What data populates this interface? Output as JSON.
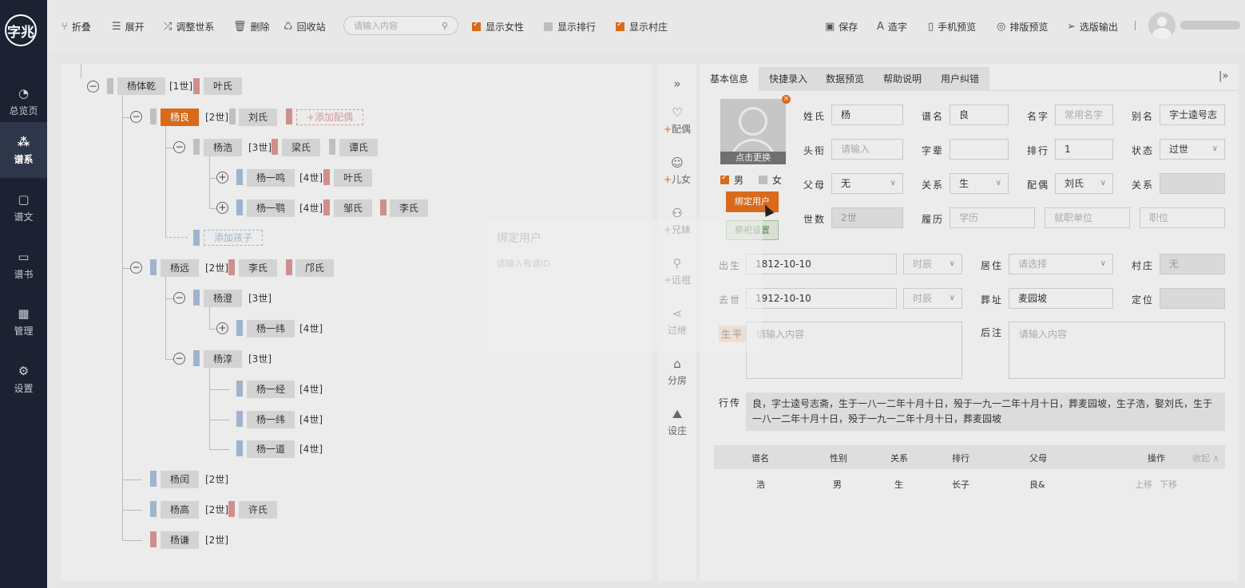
{
  "app": {
    "logo_text": "字兆"
  },
  "sidebar": {
    "items": [
      {
        "label": "总览页",
        "icon": "pie-chart-icon",
        "active": false
      },
      {
        "label": "谱系",
        "icon": "tree-icon",
        "active": true
      },
      {
        "label": "谱文",
        "icon": "document-icon",
        "active": false
      },
      {
        "label": "谱书",
        "icon": "book-icon",
        "active": false
      },
      {
        "label": "管理",
        "icon": "grid-icon",
        "active": false
      },
      {
        "label": "设置",
        "icon": "gear-icon",
        "active": false
      }
    ]
  },
  "toolbar": {
    "collapse": "折叠",
    "expand": "展开",
    "adjust": "调整世系",
    "delete": "删除",
    "recycle": "回收站",
    "search_placeholder": "请输入内容",
    "show_female": "显示女性",
    "show_rank": "显示排行",
    "show_village": "显示村庄",
    "show_female_checked": true,
    "show_rank_checked": false,
    "show_village_checked": true,
    "save": "保存",
    "make_char": "造字",
    "mobile_preview": "手机预览",
    "layout_preview": "排版预览",
    "export": "选版输出"
  },
  "tree": {
    "nodes": [
      {
        "name": "杨体乾",
        "gen": "[1世]",
        "spouses": [
          "叶氏"
        ]
      },
      {
        "name": "杨良",
        "gen": "[2世]",
        "spouses": [
          "刘氏"
        ],
        "add_spouse": "+添加配偶",
        "selected": true
      },
      {
        "name": "杨浩",
        "gen": "[3世]",
        "spouses": [
          "梁氏",
          "谭氏"
        ]
      },
      {
        "name": "杨一鸣",
        "gen": "[4世]",
        "spouses": [
          "叶氏"
        ]
      },
      {
        "name": "杨一鹗",
        "gen": "[4世]",
        "spouses": [
          "邹氏",
          "李氏"
        ]
      },
      {
        "add_child": "添加孩子"
      },
      {
        "name": "杨远",
        "gen": "[2世]",
        "spouses": [
          "李氏",
          "邝氏"
        ]
      },
      {
        "name": "杨澄",
        "gen": "[3世]"
      },
      {
        "name": "杨一纬",
        "gen": "[4世]"
      },
      {
        "name": "杨淳",
        "gen": "[3世]"
      },
      {
        "name": "杨一经",
        "gen": "[4世]"
      },
      {
        "name": "杨一纬",
        "gen": "[4世]"
      },
      {
        "name": "杨一道",
        "gen": "[4世]"
      },
      {
        "name": "杨闰",
        "gen": "[2世]"
      },
      {
        "name": "杨高",
        "gen": "[2世]",
        "spouses": [
          "许氏"
        ]
      },
      {
        "name": "杨谦",
        "gen": "[2世]"
      }
    ]
  },
  "actions": {
    "items": [
      {
        "label": "配偶",
        "plus": true,
        "icon": "heart-icon"
      },
      {
        "label": "儿女",
        "plus": true,
        "icon": "child-icon"
      },
      {
        "label": "兄妹",
        "plus": true,
        "icon": "siblings-icon"
      },
      {
        "label": "远祖",
        "plus": true,
        "icon": "ancestor-icon"
      },
      {
        "label": "过继",
        "plus": false,
        "icon": "share-icon"
      },
      {
        "label": "分房",
        "plus": false,
        "icon": "house-icon"
      },
      {
        "label": "设庄",
        "plus": false,
        "icon": "landscape-icon"
      }
    ]
  },
  "detail": {
    "tabs": [
      "基本信息",
      "快捷录入",
      "数据预览",
      "帮助说明",
      "用户纠错"
    ],
    "photo_caption": "点击更换",
    "gender_male": "男",
    "gender_female": "女",
    "bind_user": "绑定用户",
    "sacrifice": "祭祀设置",
    "fields": {
      "surname_label": "姓氏",
      "surname": "杨",
      "pu_name_label": "谱名",
      "pu_name": "良",
      "given_name_label": "名字",
      "given_name_ph": "常用名字",
      "alias_label": "别名",
      "alias": "字士逵号志",
      "title_label": "头衔",
      "title_ph": "请输入",
      "zibei_label": "字辈",
      "zibei": "",
      "rank_label": "排行",
      "rank": "1",
      "status_label": "状态",
      "status": "过世",
      "parent_label": "父母",
      "parent": "无",
      "relation_label": "关系",
      "relation": "生",
      "spouse_label": "配偶",
      "spouse": "刘氏",
      "relation2_label": "关系",
      "relation2": "",
      "gen_label": "世数",
      "gen": "2世",
      "resume_label": "履历",
      "edu_ph": "学历",
      "work_ph": "就职单位",
      "job_ph": "职位",
      "birth_label": "出生",
      "birth": "1812-10-10",
      "birth_time_ph": "时辰",
      "live_label": "居住",
      "live_ph": "请选择",
      "village_label": "村庄",
      "village": "无",
      "death_label": "去世",
      "death": "1912-10-10",
      "death_time_ph": "时辰",
      "burial_label": "葬址",
      "burial": "麦园坡",
      "locate_label": "定位",
      "locate": "",
      "life_label": "生平",
      "life_ph": "请输入内容",
      "note_label": "后注",
      "note_ph": "请输入内容"
    },
    "bio_label": "行传",
    "bio": "良，字士逵号志斋，生于一八一二年十月十日，殁于一九一二年十月十日，葬麦园坡，生子浩，娶刘氏，生于一八一二年十月十日，殁于一九一二年十月十日，葬麦园坡",
    "table": {
      "headers": [
        "谱名",
        "性别",
        "关系",
        "排行",
        "父母",
        "操作"
      ],
      "collapse": "收起",
      "rows": [
        {
          "name": "浩",
          "gender": "男",
          "relation": "生",
          "rank": "长子",
          "parent": "良&",
          "up": "上移",
          "down": "下移"
        }
      ]
    }
  },
  "ghost_dialog": {
    "title": "绑定用户",
    "placeholder": "请输入有谱ID"
  },
  "colors": {
    "accent": "#d96a1c",
    "sidebar": "#1c2232",
    "male": "#9fb4cc",
    "female": "#cf8f8f"
  }
}
